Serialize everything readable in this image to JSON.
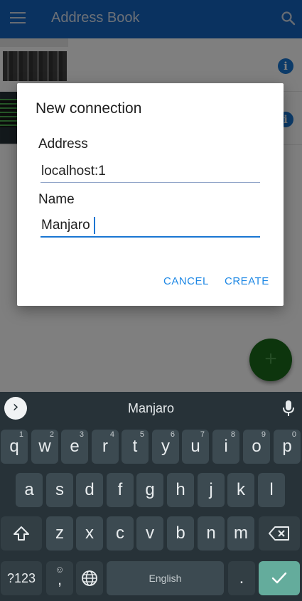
{
  "app": {
    "title": "Address Book"
  },
  "dialog": {
    "title": "New connection",
    "address_label": "Address",
    "address_value": "localhost:1",
    "name_label": "Name",
    "name_value": "Manjaro",
    "cancel_label": "CANCEL",
    "create_label": "CREATE"
  },
  "fab": {
    "label": "+"
  },
  "keyboard": {
    "suggestion": "Manjaro",
    "row1": [
      {
        "k": "q",
        "n": "1"
      },
      {
        "k": "w",
        "n": "2"
      },
      {
        "k": "e",
        "n": "3"
      },
      {
        "k": "r",
        "n": "4"
      },
      {
        "k": "t",
        "n": "5"
      },
      {
        "k": "y",
        "n": "6"
      },
      {
        "k": "u",
        "n": "7"
      },
      {
        "k": "i",
        "n": "8"
      },
      {
        "k": "o",
        "n": "9"
      },
      {
        "k": "p",
        "n": "0"
      }
    ],
    "row2": [
      "a",
      "s",
      "d",
      "f",
      "g",
      "h",
      "j",
      "k",
      "l"
    ],
    "row3": [
      "z",
      "x",
      "c",
      "v",
      "b",
      "n",
      "m"
    ],
    "symbols_label": "?123",
    "emoji_label": "☺",
    "comma_label": ",",
    "space_label": "English",
    "period_label": "."
  },
  "colors": {
    "appbar": "#1565c0",
    "accent": "#1976d2",
    "fab": "#1b6a1b",
    "keyboard_bg": "#273238",
    "enter_key": "#64ac9c"
  },
  "icons": [
    "menu-icon",
    "search-icon",
    "info-icon",
    "chevron-right-icon",
    "mic-icon",
    "shift-icon",
    "backspace-icon",
    "globe-icon",
    "check-icon"
  ]
}
